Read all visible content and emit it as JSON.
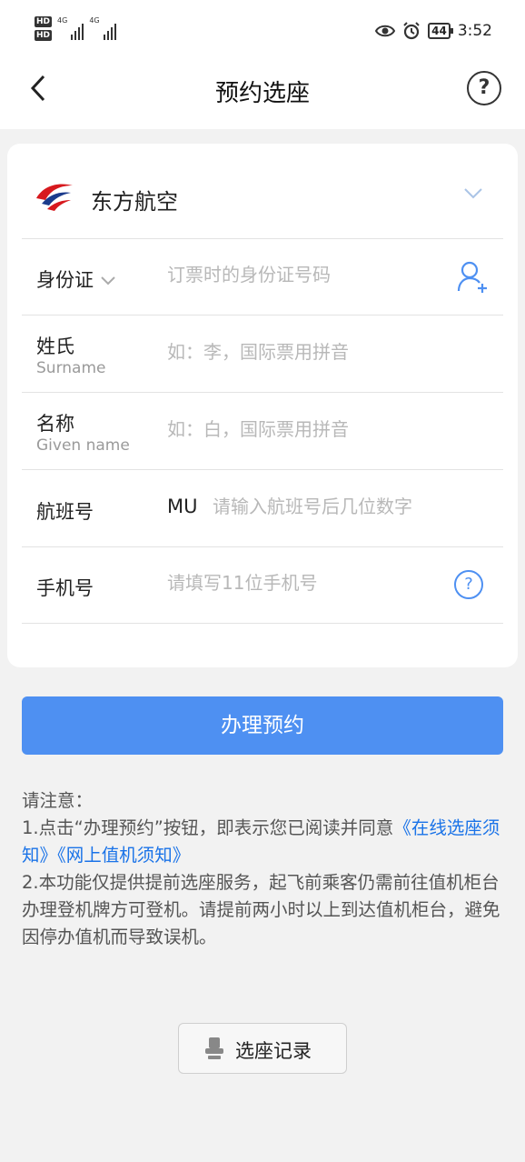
{
  "status_bar": {
    "hd1": "HD",
    "hd2": "HD",
    "net1": "4G",
    "net2": "4G",
    "battery": "44",
    "time": "3:52"
  },
  "nav": {
    "title": "预约选座",
    "help_glyph": "?"
  },
  "airline": {
    "name": "东方航空",
    "logo_colors": {
      "red": "#d7191e",
      "blue": "#1b3b8c"
    }
  },
  "form": {
    "id_type": {
      "label": "身份证",
      "placeholder": "订票时的身份证号码"
    },
    "surname": {
      "label": "姓氏",
      "sublabel": "Surname",
      "placeholder": "如：李，国际票用拼音"
    },
    "given_name": {
      "label": "名称",
      "sublabel": "Given name",
      "placeholder": "如：白，国际票用拼音"
    },
    "flight": {
      "label": "航班号",
      "prefix": "MU",
      "placeholder": "请输入航班号后几位数字"
    },
    "phone": {
      "label": "手机号",
      "placeholder": "请填写11位手机号",
      "help_glyph": "?"
    }
  },
  "submit_label": "办理预约",
  "notice": {
    "heading": "请注意：",
    "line1_text": "1.点击“办理预约”按钮，即表示您已阅读并同意",
    "link1": "《在线选座须知》",
    "link2": "《网上值机须知》",
    "line2_text": "2.本功能仅提供提前选座服务，起飞前乘客仍需前往值机柜台办理登机牌方可登机。请提前两小时以上到达值机柜台，避免因停办值机而导致误机。"
  },
  "records_label": "选座记录",
  "colors": {
    "accent": "#4e90f2",
    "link": "#1a73e8",
    "background": "#f2f2f2"
  }
}
